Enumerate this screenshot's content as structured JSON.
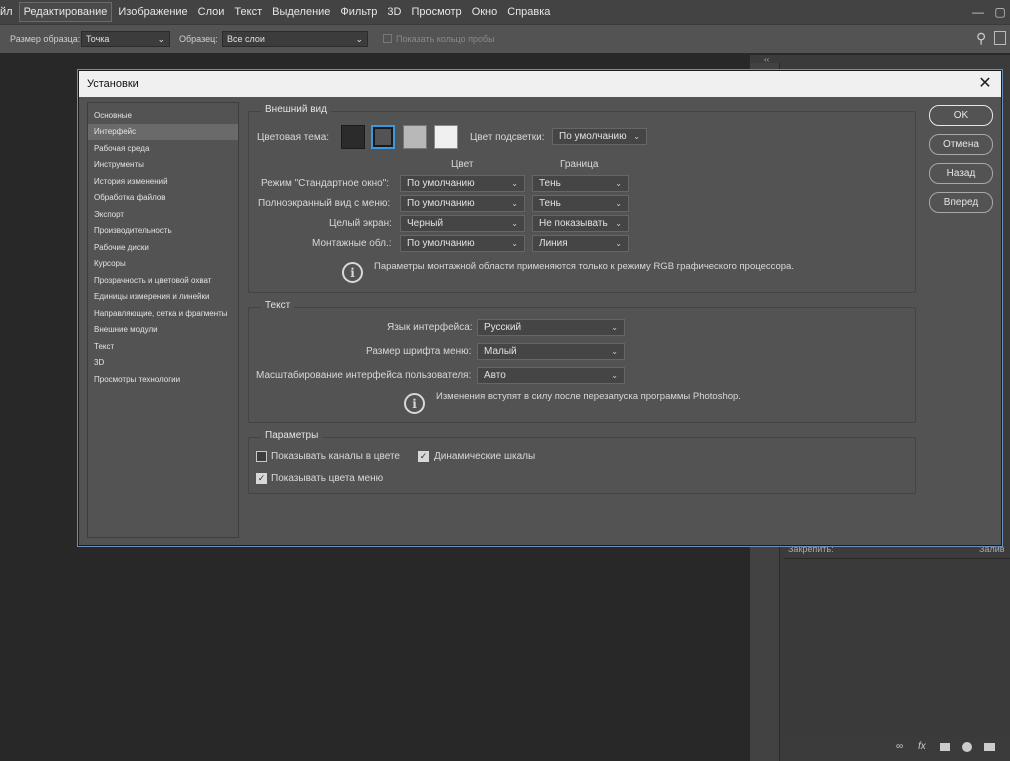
{
  "menubar": {
    "items": [
      "йл",
      "Редактирование",
      "Изображение",
      "Слои",
      "Текст",
      "Выделение",
      "Фильтр",
      "3D",
      "Просмотр",
      "Окно",
      "Справка"
    ]
  },
  "optionsbar": {
    "sample_size_label": "Размер образца:",
    "sample_size_value": "Точка",
    "sample_label": "Образец:",
    "sample_value": "Все слои",
    "show_ring_label": "Показать кольцо пробы"
  },
  "dialog": {
    "title": "Установки",
    "sidebar": [
      "Основные",
      "Интерфейс",
      "Рабочая среда",
      "Инструменты",
      "История изменений",
      "Обработка файлов",
      "Экспорт",
      "Производительность",
      "Рабочие диски",
      "Курсоры",
      "Прозрачность и цветовой охват",
      "Единицы измерения и линейки",
      "Направляющие, сетка и фрагменты",
      "Внешние модули",
      "Текст",
      "3D",
      "Просмотры технологии"
    ],
    "appearance": {
      "title": "Внешний вид",
      "color_theme_label": "Цветовая тема:",
      "highlight_label": "Цвет подсветки:",
      "highlight_value": "По умолчанию",
      "col_color": "Цвет",
      "col_border": "Граница",
      "rows": [
        {
          "label": "Режим \"Стандартное окно\":",
          "color": "По умолчанию",
          "border": "Тень"
        },
        {
          "label": "Полноэкранный вид с меню:",
          "color": "По умолчанию",
          "border": "Тень"
        },
        {
          "label": "Целый экран:",
          "color": "Черный",
          "border": "Не показывать"
        },
        {
          "label": "Монтажные обл.:",
          "color": "По умолчанию",
          "border": "Линия"
        }
      ],
      "info_text": "Параметры монтажной области применяются только к режиму RGB графического процессора.",
      "swatch_colors": [
        "#2b2b2b",
        "#535353",
        "#b8b8b8",
        "#f0f0f0"
      ]
    },
    "text_section": {
      "title": "Текст",
      "language_label": "Язык интерфейса:",
      "language_value": "Русский",
      "font_size_label": "Размер шрифта меню:",
      "font_size_value": "Малый",
      "scaling_label": "Масштабирование интерфейса пользователя:",
      "scaling_value": "Авто",
      "info_text": "Изменения вступят в силу после перезапуска программы Photoshop."
    },
    "params": {
      "title": "Параметры",
      "show_channels": "Показывать каналы в цвете",
      "show_channels_checked": false,
      "dynamic_sliders": "Динамические шкалы",
      "dynamic_sliders_checked": true,
      "show_menu_colors": "Показывать цвета меню",
      "show_menu_colors_checked": true
    },
    "buttons": {
      "ok": "OK",
      "cancel": "Отмена",
      "back": "Назад",
      "forward": "Вперед"
    }
  },
  "layers_panel": {
    "lock_label": "Закрепить:",
    "fill_label": "Залив"
  }
}
